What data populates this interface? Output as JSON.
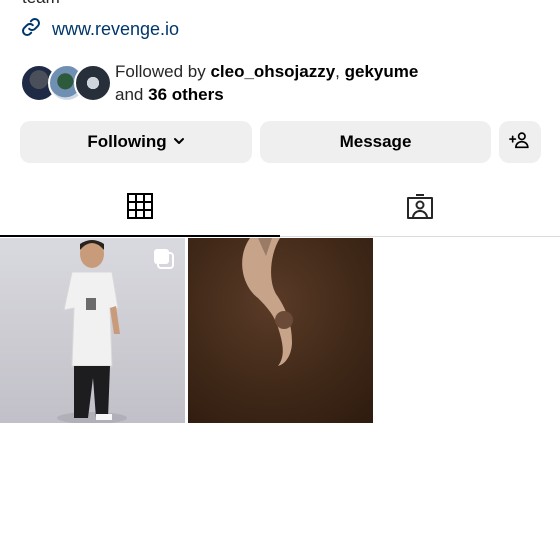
{
  "profile": {
    "bio_tail": "team",
    "link": "www.revenge.io",
    "followed_by_prefix": "Followed by",
    "followed_by_users": [
      "cleo_ohsojazzy",
      "gekyume"
    ],
    "followed_by_and": "and",
    "followed_by_others": "36 others"
  },
  "actions": {
    "following_label": "Following",
    "message_label": "Message"
  },
  "tabs": [
    {
      "name": "posts-grid",
      "icon": "grid-icon",
      "active": true
    },
    {
      "name": "tagged",
      "icon": "tagged-person-icon",
      "active": false
    }
  ],
  "posts": [
    {
      "type": "carousel",
      "badge_icon": "multiple-posts-icon"
    },
    {
      "type": "single"
    }
  ],
  "colors": {
    "link": "#00376b",
    "button_bg": "#efefef",
    "text": "#262626"
  }
}
